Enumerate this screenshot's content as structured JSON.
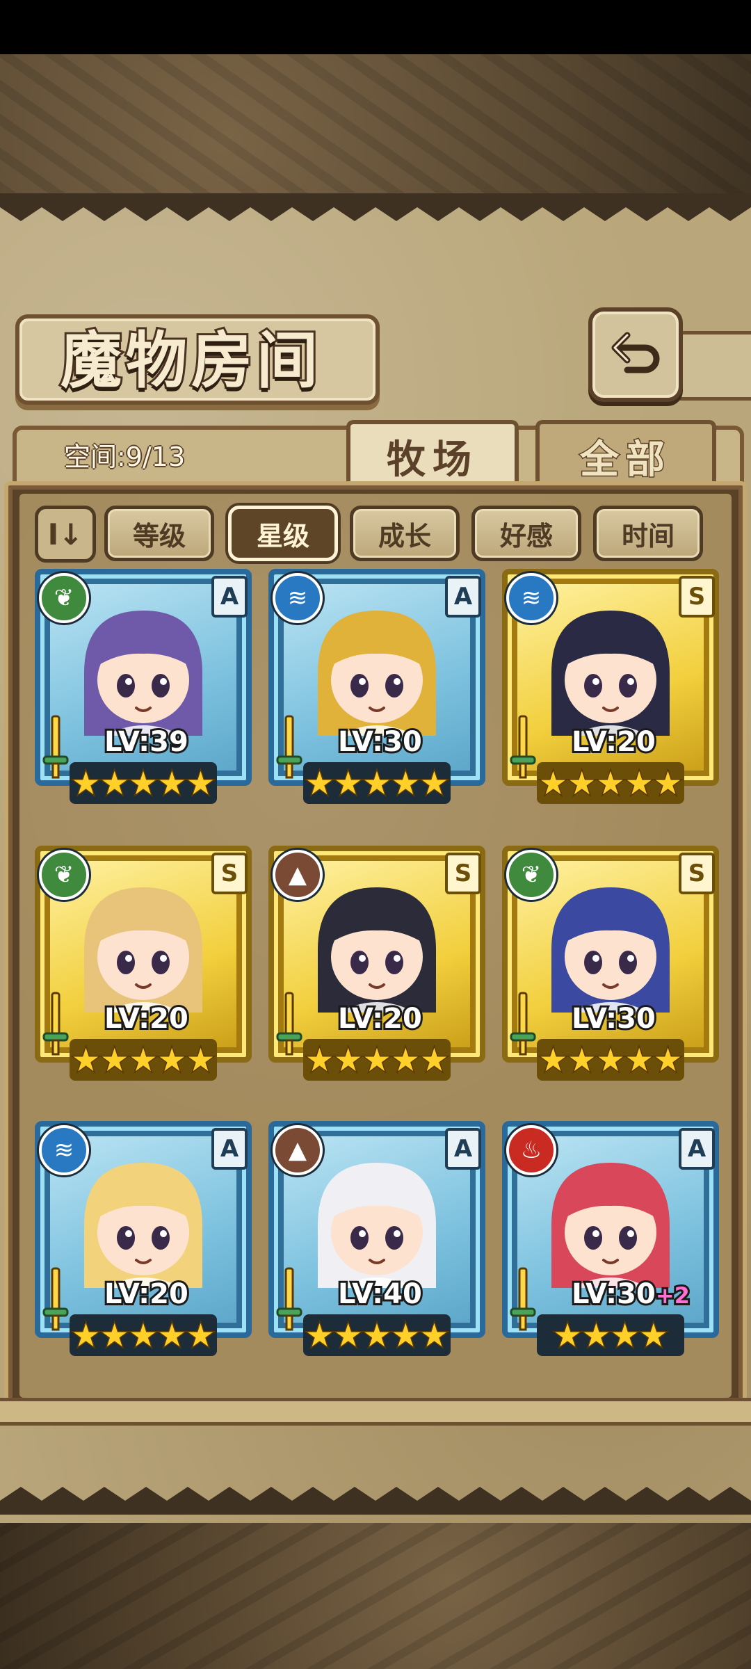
{
  "header": {
    "title": "魔物房间",
    "back_icon": "back-arrow-icon"
  },
  "tabs": {
    "space_label": "空间:9/13",
    "ranch_label": "牧场",
    "all_label": "全部",
    "active": "牧场"
  },
  "filters": {
    "sort_toggle_label": "I↓",
    "items": [
      "等级",
      "星级",
      "成长",
      "好感",
      "时间"
    ],
    "active": "星级"
  },
  "colors": {
    "blue_frame": "#2a6a9a",
    "gold_frame": "#c69a16",
    "star": "#ffcf2a"
  },
  "monsters": [
    {
      "element": "grass",
      "element_icon": "leaf-icon",
      "rank": "A",
      "frame": "blue",
      "level": "LV:39",
      "plus": "",
      "stars": 5
    },
    {
      "element": "water",
      "element_icon": "wave-icon",
      "rank": "A",
      "frame": "blue",
      "level": "LV:30",
      "plus": "",
      "stars": 5
    },
    {
      "element": "water",
      "element_icon": "wave-icon",
      "rank": "S",
      "frame": "gold",
      "level": "LV:20",
      "plus": "",
      "stars": 5
    },
    {
      "element": "grass",
      "element_icon": "leaf-icon",
      "rank": "S",
      "frame": "gold",
      "level": "LV:20",
      "plus": "",
      "stars": 5
    },
    {
      "element": "earth",
      "element_icon": "mountain-icon",
      "rank": "S",
      "frame": "gold",
      "level": "LV:20",
      "plus": "",
      "stars": 5
    },
    {
      "element": "grass",
      "element_icon": "leaf-icon",
      "rank": "S",
      "frame": "gold",
      "level": "LV:30",
      "plus": "",
      "stars": 5
    },
    {
      "element": "water",
      "element_icon": "wave-icon",
      "rank": "A",
      "frame": "blue",
      "level": "LV:20",
      "plus": "",
      "stars": 5
    },
    {
      "element": "earth",
      "element_icon": "mountain-icon",
      "rank": "A",
      "frame": "blue",
      "level": "LV:40",
      "plus": "",
      "stars": 5
    },
    {
      "element": "fire",
      "element_icon": "flame-icon",
      "rank": "A",
      "frame": "blue",
      "level": "LV:30",
      "plus": "+2",
      "stars": 4
    }
  ]
}
